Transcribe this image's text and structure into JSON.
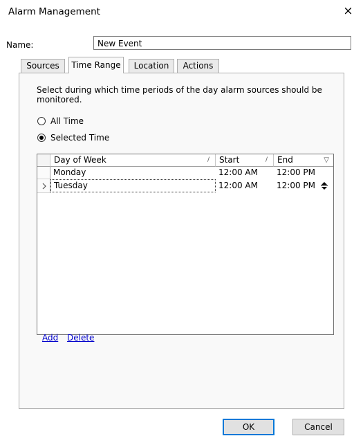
{
  "window": {
    "title": "Alarm Management",
    "close_glyph": "×"
  },
  "name": {
    "label": "Name:",
    "value": "New Event"
  },
  "tabs": [
    {
      "label": "Sources",
      "active": false
    },
    {
      "label": "Time Range",
      "active": true
    },
    {
      "label": "Location",
      "active": false
    },
    {
      "label": "Actions",
      "active": false
    }
  ],
  "time_range": {
    "instructions": "Select during which time periods of the day alarm sources should be monitored.",
    "options": [
      {
        "label": "All Time",
        "selected": false
      },
      {
        "label": "Selected Time",
        "selected": true
      }
    ]
  },
  "grid": {
    "columns": [
      "Day of Week",
      "Start",
      "End"
    ],
    "rows": [
      {
        "day": "Monday",
        "start": "12:00 AM",
        "end": "12:00 PM",
        "current": false
      },
      {
        "day": "Tuesday",
        "start": "12:00 AM",
        "end": "12:00 PM",
        "current": true
      }
    ]
  },
  "links": {
    "add": "Add",
    "delete": "Delete"
  },
  "buttons": {
    "ok": "OK",
    "cancel": "Cancel"
  }
}
